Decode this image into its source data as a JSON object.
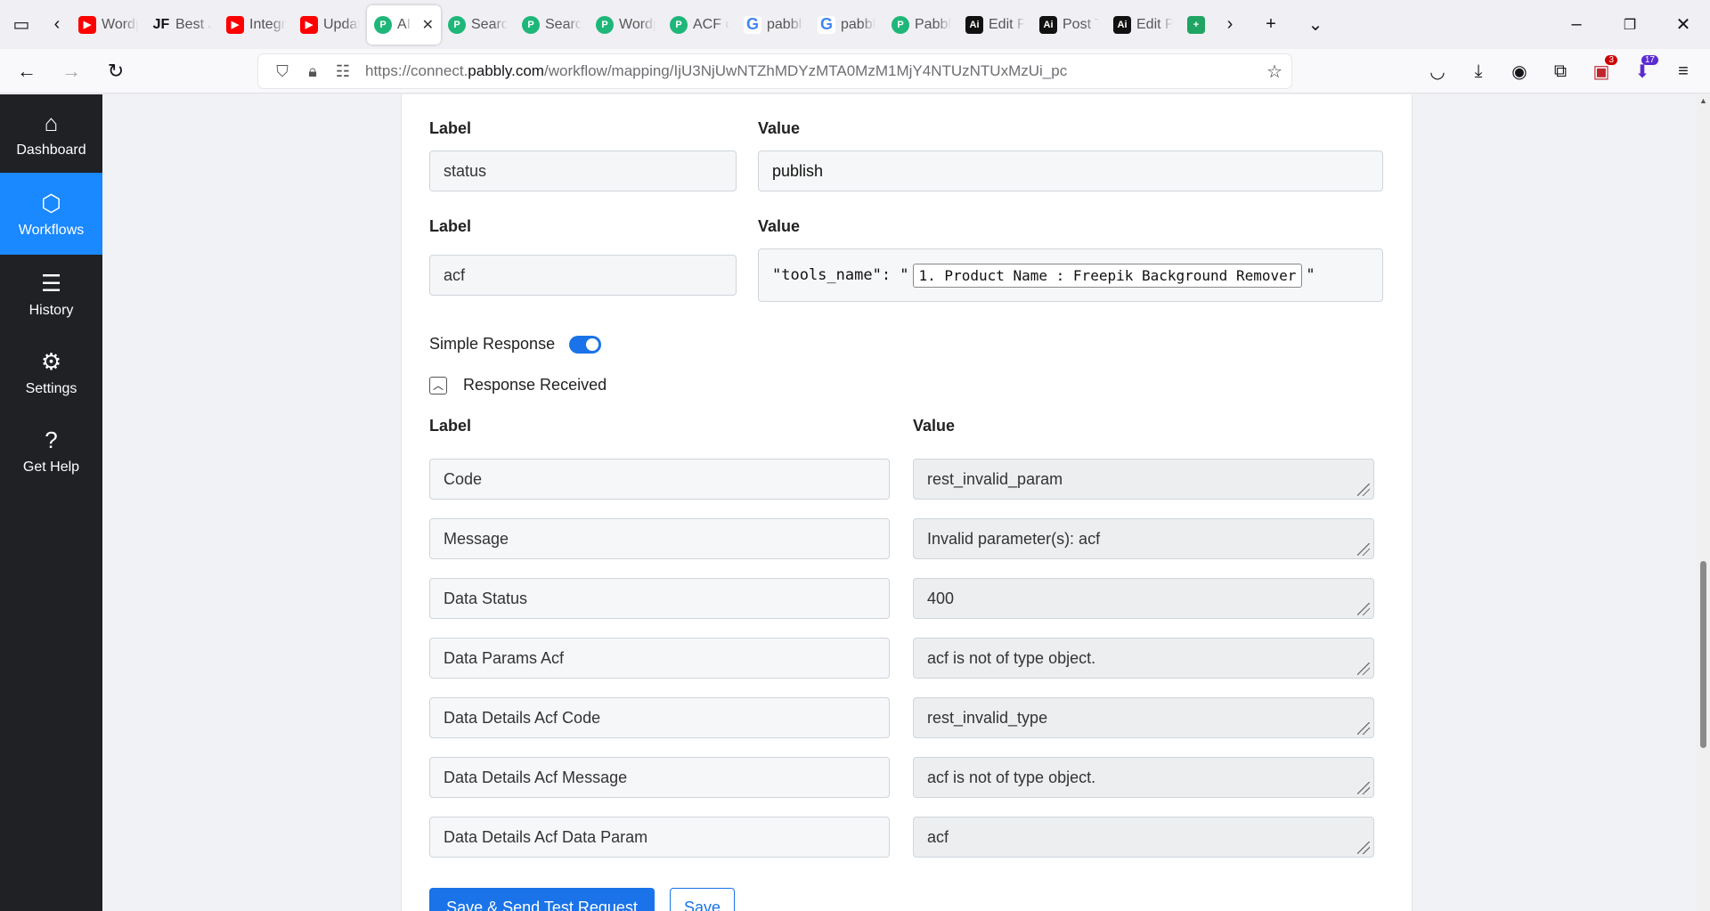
{
  "browser": {
    "tabs": [
      {
        "title": "Wordp",
        "icon": "youtube",
        "cls": "yt",
        "glyph": "▶"
      },
      {
        "title": "Best JS",
        "icon": "jotform",
        "cls": "jf",
        "glyph": "JF"
      },
      {
        "title": "Integr",
        "icon": "youtube",
        "cls": "yt",
        "glyph": "▶"
      },
      {
        "title": "Updat",
        "icon": "youtube",
        "cls": "yt",
        "glyph": "▶"
      },
      {
        "title": "AI",
        "icon": "pabbly",
        "cls": "pb",
        "glyph": "P",
        "active": true
      },
      {
        "title": "Search",
        "icon": "pabbly",
        "cls": "pb",
        "glyph": "P"
      },
      {
        "title": "Search",
        "icon": "pabbly",
        "cls": "pb",
        "glyph": "P"
      },
      {
        "title": "Wordp",
        "icon": "pabbly",
        "cls": "pb",
        "glyph": "P"
      },
      {
        "title": "ACF cu",
        "icon": "pabbly",
        "cls": "pb",
        "glyph": "P"
      },
      {
        "title": "pabbly",
        "icon": "google",
        "cls": "gg",
        "glyph": "G"
      },
      {
        "title": "pabbl",
        "icon": "google",
        "cls": "gg",
        "glyph": "G"
      },
      {
        "title": "Pabbly",
        "icon": "pabbly",
        "cls": "pb",
        "glyph": "P"
      },
      {
        "title": "Edit Fi",
        "icon": "ai-tool",
        "cls": "ai",
        "glyph": "Ai"
      },
      {
        "title": "Post Ty",
        "icon": "ai-tool",
        "cls": "ai",
        "glyph": "Ai"
      },
      {
        "title": "Edit Po",
        "icon": "ai-tool",
        "cls": "ai",
        "glyph": "Ai"
      },
      {
        "title": "",
        "icon": "sheets",
        "cls": "gs",
        "glyph": "+"
      }
    ],
    "url_prefix": "https://connect.",
    "url_domain": "pabbly.com",
    "url_path": "/workflow/mapping/IjU3NjUwNTZhMDYzMTA0MzM1MjY4NTUzNTUxMzUi_pc",
    "badges": {
      "ext1": "3",
      "ext2": "17"
    }
  },
  "sidebar": {
    "items": [
      {
        "label": "Dashboard",
        "icon": "home-icon",
        "glyph": "⌂"
      },
      {
        "label": "Workflows",
        "icon": "workflow-icon",
        "glyph": "⬡",
        "active": true
      },
      {
        "label": "History",
        "icon": "history-list-icon",
        "glyph": "☰"
      },
      {
        "label": "Settings",
        "icon": "gear-icon",
        "glyph": "⚙"
      },
      {
        "label": "Get Help",
        "icon": "help-icon",
        "glyph": "?"
      }
    ]
  },
  "mapping": {
    "label_header": "Label",
    "value_header": "Value",
    "rows": [
      {
        "label": "status",
        "value": "publish"
      },
      {
        "label": "acf",
        "value_prefix": "\"tools_name\": \"",
        "token": "1. Product Name : Freepik Background Remover",
        "value_suffix": "\""
      }
    ]
  },
  "simple_response": {
    "label": "Simple Response",
    "enabled": true
  },
  "response": {
    "title": "Response Received",
    "label_header": "Label",
    "value_header": "Value",
    "rows": [
      {
        "label": "Code",
        "value": "rest_invalid_param"
      },
      {
        "label": "Message",
        "value": "Invalid parameter(s): acf"
      },
      {
        "label": "Data Status",
        "value": "400"
      },
      {
        "label": "Data Params Acf",
        "value": "acf is not of type object."
      },
      {
        "label": "Data Details Acf Code",
        "value": "rest_invalid_type"
      },
      {
        "label": "Data Details Acf Message",
        "value": "acf is not of type object."
      },
      {
        "label": "Data Details Acf Data Param",
        "value": "acf"
      }
    ]
  },
  "actions": {
    "primary": "Save & Send Test Request",
    "secondary": "Save"
  }
}
